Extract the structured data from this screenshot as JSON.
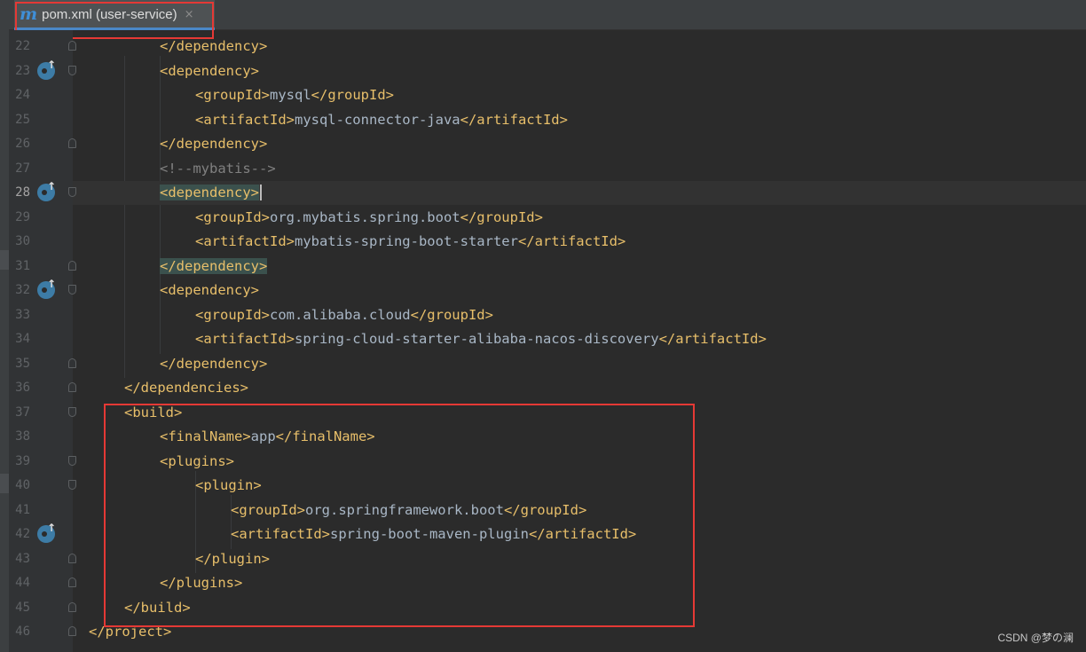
{
  "tab": {
    "icon": "m",
    "label": "pom.xml (user-service)",
    "close": "×"
  },
  "editor": {
    "current_line": 28,
    "lines": [
      {
        "num": "22",
        "indent": 2,
        "segments": [
          {
            "t": "</dependency>",
            "c": "tag"
          }
        ],
        "fold": "close",
        "maven": false
      },
      {
        "num": "23",
        "indent": 2,
        "segments": [
          {
            "t": "<dependency>",
            "c": "tag"
          }
        ],
        "fold": "open",
        "maven": true
      },
      {
        "num": "24",
        "indent": 3,
        "segments": [
          {
            "t": "<groupId>",
            "c": "tag"
          },
          {
            "t": "mysql",
            "c": "text"
          },
          {
            "t": "</groupId>",
            "c": "tag"
          }
        ],
        "fold": "",
        "maven": false
      },
      {
        "num": "25",
        "indent": 3,
        "segments": [
          {
            "t": "<artifactId>",
            "c": "tag"
          },
          {
            "t": "mysql-connector-java",
            "c": "text"
          },
          {
            "t": "</artifactId>",
            "c": "tag"
          }
        ],
        "fold": "",
        "maven": false
      },
      {
        "num": "26",
        "indent": 2,
        "segments": [
          {
            "t": "</dependency>",
            "c": "tag"
          }
        ],
        "fold": "close",
        "maven": false
      },
      {
        "num": "27",
        "indent": 2,
        "segments": [
          {
            "t": "<!--mybatis-->",
            "c": "comment"
          }
        ],
        "fold": "",
        "maven": false
      },
      {
        "num": "28",
        "indent": 2,
        "segments": [
          {
            "t": "<dependency>",
            "c": "tag match"
          }
        ],
        "fold": "open",
        "maven": true,
        "caret": true
      },
      {
        "num": "29",
        "indent": 3,
        "segments": [
          {
            "t": "<groupId>",
            "c": "tag"
          },
          {
            "t": "org.mybatis.spring.boot",
            "c": "text"
          },
          {
            "t": "</groupId>",
            "c": "tag"
          }
        ],
        "fold": "",
        "maven": false
      },
      {
        "num": "30",
        "indent": 3,
        "segments": [
          {
            "t": "<artifactId>",
            "c": "tag"
          },
          {
            "t": "mybatis-spring-boot-starter",
            "c": "text"
          },
          {
            "t": "</artifactId>",
            "c": "tag"
          }
        ],
        "fold": "",
        "maven": false
      },
      {
        "num": "31",
        "indent": 2,
        "segments": [
          {
            "t": "</dependency>",
            "c": "tag match"
          }
        ],
        "fold": "close",
        "maven": false
      },
      {
        "num": "32",
        "indent": 2,
        "segments": [
          {
            "t": "<dependency>",
            "c": "tag"
          }
        ],
        "fold": "open",
        "maven": true
      },
      {
        "num": "33",
        "indent": 3,
        "segments": [
          {
            "t": "<groupId>",
            "c": "tag"
          },
          {
            "t": "com.alibaba.cloud",
            "c": "text"
          },
          {
            "t": "</groupId>",
            "c": "tag"
          }
        ],
        "fold": "",
        "maven": false
      },
      {
        "num": "34",
        "indent": 3,
        "segments": [
          {
            "t": "<artifactId>",
            "c": "tag"
          },
          {
            "t": "spring-cloud-starter-alibaba-nacos-discovery",
            "c": "text"
          },
          {
            "t": "</artifactId>",
            "c": "tag"
          }
        ],
        "fold": "",
        "maven": false
      },
      {
        "num": "35",
        "indent": 2,
        "segments": [
          {
            "t": "</dependency>",
            "c": "tag"
          }
        ],
        "fold": "close",
        "maven": false
      },
      {
        "num": "36",
        "indent": 1,
        "segments": [
          {
            "t": "</dependencies>",
            "c": "tag"
          }
        ],
        "fold": "close",
        "maven": false
      },
      {
        "num": "37",
        "indent": 1,
        "segments": [
          {
            "t": "<build>",
            "c": "tag"
          }
        ],
        "fold": "open",
        "maven": false
      },
      {
        "num": "38",
        "indent": 2,
        "segments": [
          {
            "t": "<finalName>",
            "c": "tag"
          },
          {
            "t": "app",
            "c": "text"
          },
          {
            "t": "</finalName>",
            "c": "tag"
          }
        ],
        "fold": "",
        "maven": false
      },
      {
        "num": "39",
        "indent": 2,
        "segments": [
          {
            "t": "<plugins>",
            "c": "tag"
          }
        ],
        "fold": "open",
        "maven": false
      },
      {
        "num": "40",
        "indent": 3,
        "segments": [
          {
            "t": "<plugin>",
            "c": "tag"
          }
        ],
        "fold": "open",
        "maven": false
      },
      {
        "num": "41",
        "indent": 4,
        "segments": [
          {
            "t": "<groupId>",
            "c": "tag"
          },
          {
            "t": "org.springframework.boot",
            "c": "text"
          },
          {
            "t": "</groupId>",
            "c": "tag"
          }
        ],
        "fold": "",
        "maven": false
      },
      {
        "num": "42",
        "indent": 4,
        "segments": [
          {
            "t": "<artifactId>",
            "c": "tag"
          },
          {
            "t": "spring-boot-maven-plugin",
            "c": "text"
          },
          {
            "t": "</artifactId>",
            "c": "tag"
          }
        ],
        "fold": "",
        "maven": true
      },
      {
        "num": "43",
        "indent": 3,
        "segments": [
          {
            "t": "</plugin>",
            "c": "tag"
          }
        ],
        "fold": "close",
        "maven": false
      },
      {
        "num": "44",
        "indent": 2,
        "segments": [
          {
            "t": "</plugins>",
            "c": "tag"
          }
        ],
        "fold": "close",
        "maven": false
      },
      {
        "num": "45",
        "indent": 1,
        "segments": [
          {
            "t": "</build>",
            "c": "tag"
          }
        ],
        "fold": "close",
        "maven": false
      },
      {
        "num": "46",
        "indent": 0,
        "segments": [
          {
            "t": "</project>",
            "c": "tag"
          }
        ],
        "fold": "close",
        "maven": false
      }
    ]
  },
  "watermark": "CSDN @梦の澜",
  "colors": {
    "background": "#2b2b2b",
    "gutter": "#313335",
    "tag": "#e8bf6a",
    "text": "#a9b7c6",
    "comment": "#808080",
    "maven_icon": "#3d7ca6",
    "highlight_box": "#e53935"
  }
}
